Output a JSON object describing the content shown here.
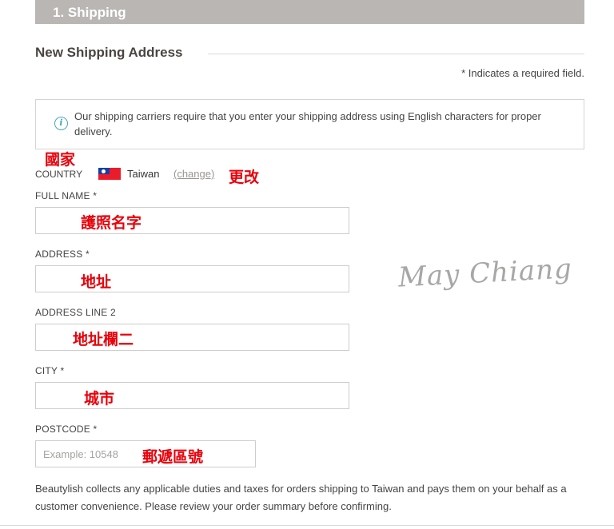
{
  "step": {
    "title": "1. Shipping"
  },
  "section": {
    "title": "New Shipping Address"
  },
  "required_note": "* Indicates a required field.",
  "info": {
    "text": "Our shipping carriers require that you enter your shipping address using English characters for proper delivery."
  },
  "country": {
    "label": "COUNTRY",
    "value": "Taiwan",
    "change_label": "(change)"
  },
  "fields": {
    "full_name": {
      "label": "FULL NAME *",
      "value": ""
    },
    "address": {
      "label": "ADDRESS *",
      "value": ""
    },
    "address2": {
      "label": "ADDRESS LINE 2",
      "value": ""
    },
    "city": {
      "label": "CITY *",
      "value": ""
    },
    "postcode": {
      "label": "POSTCODE *",
      "placeholder": "Example: 10548",
      "value": ""
    }
  },
  "annotations": {
    "country": "國家",
    "change": "更改",
    "full_name": "護照名字",
    "address": "地址",
    "address2": "地址欄二",
    "city": "城市",
    "postcode": "郵遞區號"
  },
  "watermark": "May Chiang",
  "footer": {
    "text": "Beautylish collects any applicable duties and taxes for orders shipping to Taiwan and pays them on your behalf as a customer convenience. Please review your order summary before confirming."
  },
  "colors": {
    "annotation": "#e8000a",
    "step_bar": "#b9b6b3",
    "info_icon": "#4aa6b8"
  }
}
